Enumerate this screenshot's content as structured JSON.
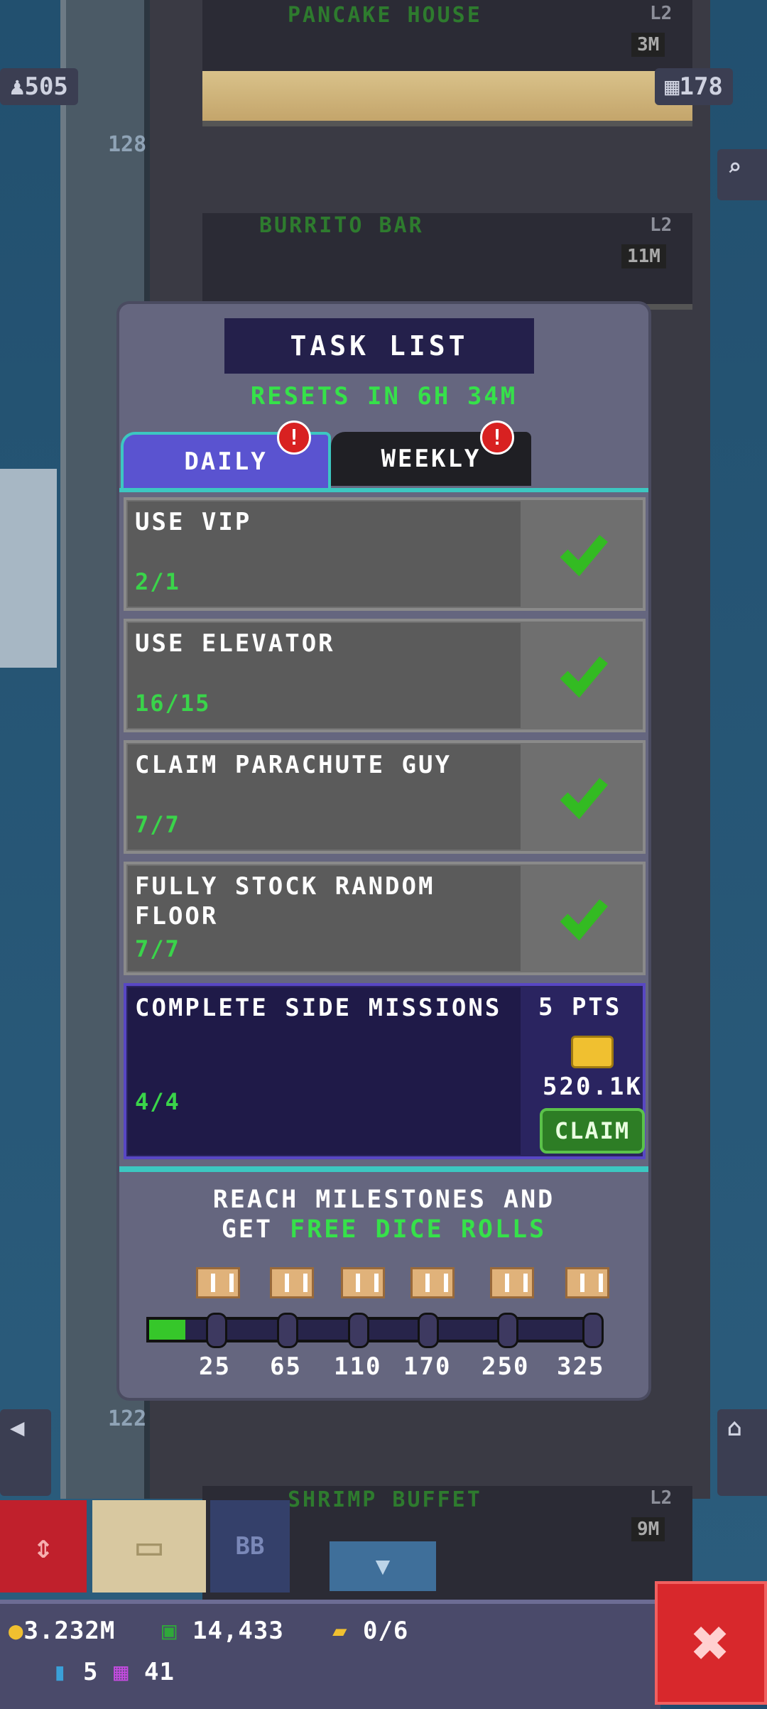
{
  "hud": {
    "population": "505",
    "floors": "178"
  },
  "floors": [
    {
      "name": "PANCAKE HOUSE",
      "level": "L2",
      "stock": "3M"
    },
    {
      "name": "BURRITO BAR",
      "level": "L2",
      "stock": "11M"
    },
    {
      "name": "SHRIMP BUFFET",
      "level": "L2",
      "stock": "9M"
    }
  ],
  "floor_numbers": [
    "128",
    "122"
  ],
  "task_list": {
    "title": "TASK LIST",
    "resets": "RESETS IN 6H 34M",
    "tabs": [
      {
        "label": "DAILY",
        "badge": "!"
      },
      {
        "label": "WEEKLY",
        "badge": "!"
      }
    ],
    "tasks": [
      {
        "name": "USE VIP",
        "progress": "2/1",
        "done": true
      },
      {
        "name": "USE ELEVATOR",
        "progress": "16/15",
        "done": true
      },
      {
        "name": "CLAIM PARACHUTE GUY",
        "progress": "7/7",
        "done": true
      },
      {
        "name": "FULLY STOCK RANDOM FLOOR",
        "progress": "7/7",
        "done": true
      }
    ],
    "bonus_task": {
      "name": "COMPLETE SIDE MISSIONS",
      "progress": "4/4",
      "points": "5 PTS",
      "reward": "520.1K",
      "claim_label": "CLAIM"
    },
    "milestones": {
      "text_line1": "REACH MILESTONES AND",
      "text_prefix": "GET ",
      "text_highlight": "FREE DICE ROLLS",
      "values": [
        "25",
        "65",
        "110",
        "170",
        "250",
        "325"
      ],
      "progress_fraction": 0.08
    }
  },
  "toolbar": {
    "bb_label": "BB"
  },
  "status": {
    "coins": "3.232M",
    "bux": "14,433",
    "tickets": "0/6",
    "keys": "5",
    "dice": "41"
  },
  "colors": {
    "accent_green": "#36e14a",
    "panel": "#65667f",
    "tab_active": "#5a53d0",
    "close_red": "#d8282c"
  }
}
